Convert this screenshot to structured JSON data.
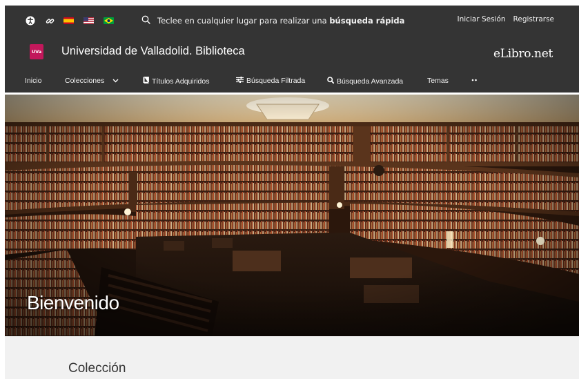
{
  "top_bar": {
    "search_placeholder_prefix": "Teclee en cualquier lugar para realizar una ",
    "search_placeholder_bold": "búsqueda rápida",
    "login_label": "Iniciar Sesión",
    "register_label": "Registrarse"
  },
  "brand": {
    "logo_text": "UVa",
    "institution_name": "Universidad de Valladolid. Biblioteca",
    "platform_name": "eLibro.net"
  },
  "nav": {
    "items": [
      {
        "label": "Inicio"
      },
      {
        "label": "Colecciones"
      },
      {
        "label": "Títulos Adquiridos"
      },
      {
        "label": "Búsqueda Filtrada"
      },
      {
        "label": "Búsqueda Avanzada"
      },
      {
        "label": "Temas"
      }
    ]
  },
  "hero": {
    "title": "Bienvenido"
  },
  "section": {
    "title": "Colección"
  },
  "colors": {
    "header_bg": "#343434",
    "section_bg": "#f1f1f1",
    "logo_bg": "#c2185b"
  }
}
